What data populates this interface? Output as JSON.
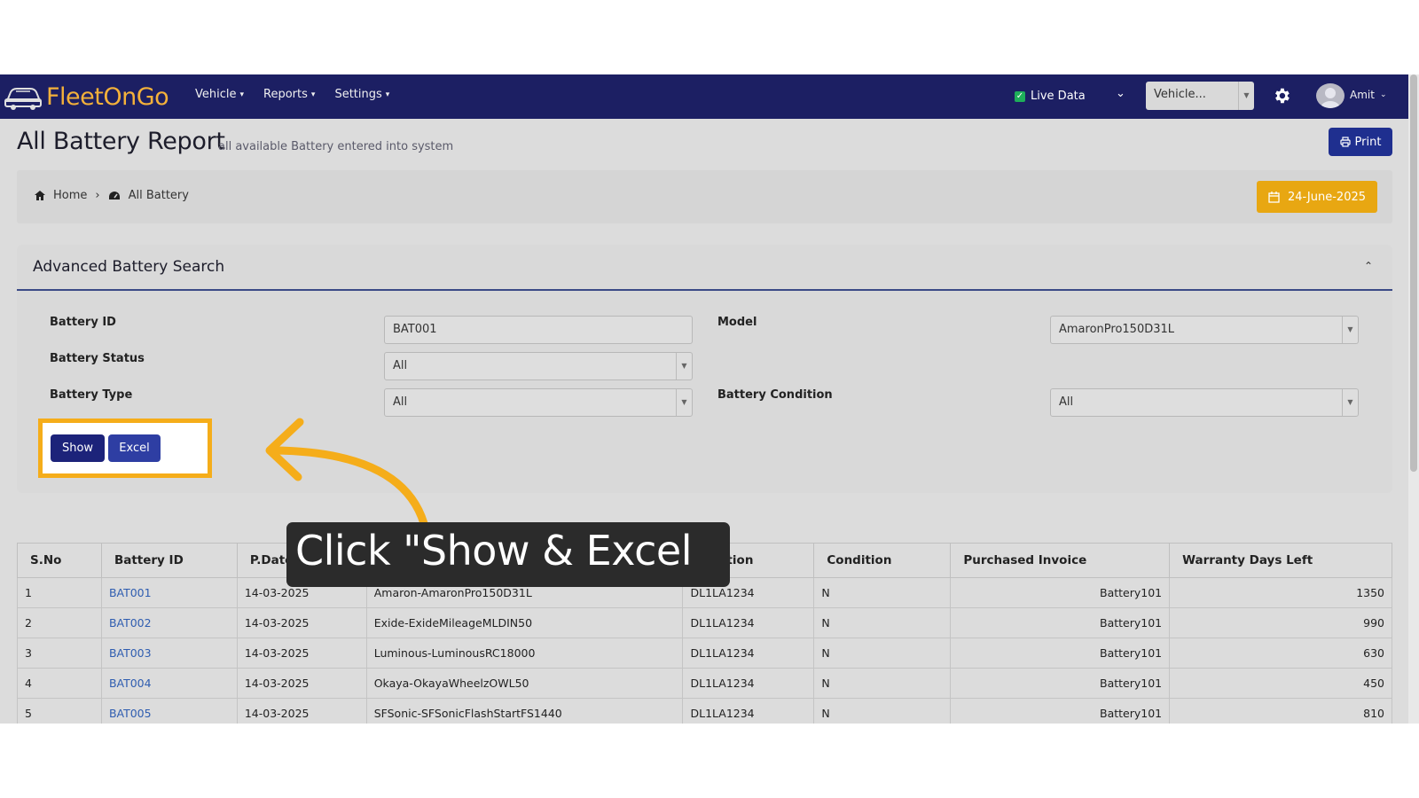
{
  "app": {
    "logo_text_a": "Fleet",
    "logo_text_b": "OnGo"
  },
  "nav": {
    "items": [
      {
        "label": "Vehicle"
      },
      {
        "label": "Reports"
      },
      {
        "label": "Settings"
      }
    ],
    "live_data_label": "Live Data",
    "vehicle_select_value": "Vehicle...",
    "user_name": "Amit"
  },
  "header": {
    "title": "All Battery Report",
    "subtitle": "all available Battery entered into system",
    "print_label": "Print"
  },
  "breadcrumb": {
    "home": "Home",
    "current": "All Battery",
    "date": "24-June-2025"
  },
  "search": {
    "title": "Advanced Battery Search",
    "battery_id_label": "Battery ID",
    "battery_id_value": "BAT001",
    "model_label": "Model",
    "model_value": "AmaronPro150D31L",
    "status_label": "Battery Status",
    "status_value": "All",
    "type_label": "Battery Type",
    "type_value": "All",
    "condition_label": "Battery Condition",
    "condition_value": "All",
    "show_label": "Show",
    "excel_label": "Excel"
  },
  "tooltip": {
    "text": "Click \"Show & Excel"
  },
  "table": {
    "headers": [
      "S.No",
      "Battery ID",
      "P.Date",
      "",
      "Location",
      "Condition",
      "Purchased Invoice",
      "Warranty Days Left"
    ],
    "rows": [
      [
        "1",
        "BAT001",
        "14-03-2025",
        "Amaron-AmaronPro150D31L",
        "DL1LA1234",
        "N",
        "Battery101",
        "1350"
      ],
      [
        "2",
        "BAT002",
        "14-03-2025",
        "Exide-ExideMileageMLDIN50",
        "DL1LA1234",
        "N",
        "Battery101",
        "990"
      ],
      [
        "3",
        "BAT003",
        "14-03-2025",
        "Luminous-LuminousRC18000",
        "DL1LA1234",
        "N",
        "Battery101",
        "630"
      ],
      [
        "4",
        "BAT004",
        "14-03-2025",
        "Okaya-OkayaWheelzOWL50",
        "DL1LA1234",
        "N",
        "Battery101",
        "450"
      ],
      [
        "5",
        "BAT005",
        "14-03-2025",
        "SFSonic-SFSonicFlashStartFS1440",
        "DL1LA1234",
        "N",
        "Battery101",
        "810"
      ]
    ]
  },
  "colors": {
    "navbar": "#1c1f63",
    "accent": "#f5ad1a",
    "primary_button": "#1c237a"
  }
}
